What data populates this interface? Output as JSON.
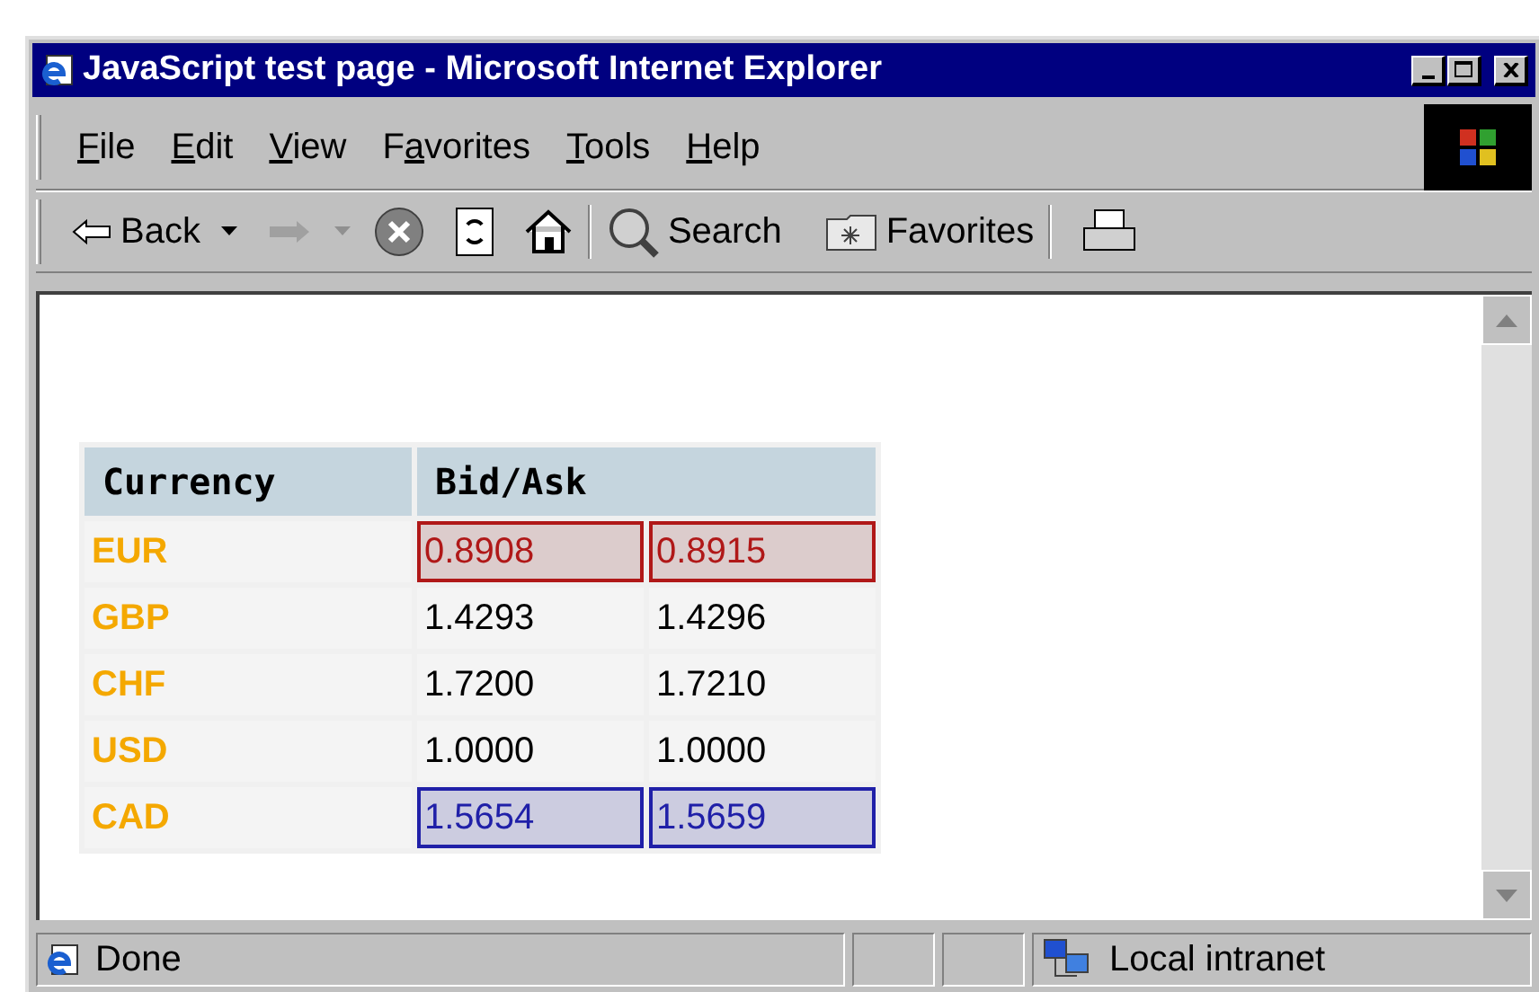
{
  "window": {
    "title": "JavaScript test page - Microsoft Internet Explorer"
  },
  "menu": [
    {
      "key": "F",
      "post": "ile"
    },
    {
      "key": "E",
      "post": "dit"
    },
    {
      "key": "V",
      "post": "iew"
    },
    {
      "pre": "F",
      "key": "a",
      "post": "vorites"
    },
    {
      "key": "T",
      "post": "ools"
    },
    {
      "key": "H",
      "post": "elp"
    }
  ],
  "toolbar": {
    "back": "Back",
    "search": "Search",
    "favorites": "Favorites"
  },
  "table": {
    "columns": [
      "Currency",
      "Bid/Ask"
    ],
    "rows": [
      {
        "currency": "EUR",
        "bid": "0.8908",
        "ask": "0.8915",
        "kind": "fall"
      },
      {
        "currency": "GBP",
        "bid": "1.4293",
        "ask": "1.4296",
        "kind": "plain"
      },
      {
        "currency": "CHF",
        "bid": "1.7200",
        "ask": "1.7210",
        "kind": "plain"
      },
      {
        "currency": "USD",
        "bid": "1.0000",
        "ask": "1.0000",
        "kind": "plain"
      },
      {
        "currency": "CAD",
        "bid": "1.5654",
        "ask": "1.5659",
        "kind": "rise"
      }
    ]
  },
  "status_bar": {
    "text": "Done",
    "zone": "Local intranet"
  }
}
